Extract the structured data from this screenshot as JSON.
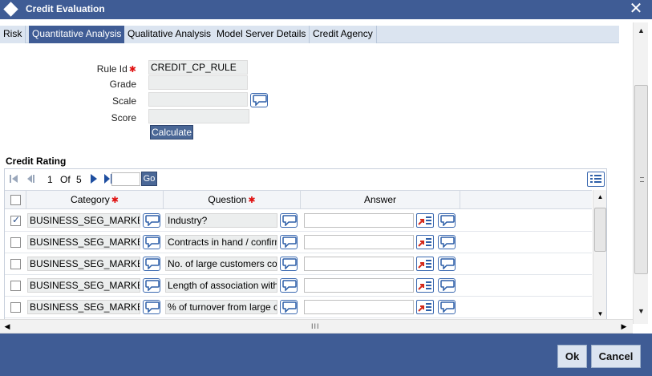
{
  "window": {
    "title": "Credit Evaluation",
    "close_label": "✕"
  },
  "tabs": [
    {
      "label": "Risk",
      "active": false
    },
    {
      "label": "Quantitative Analysis",
      "active": true
    },
    {
      "label": "Qualitative Analysis",
      "active": false
    },
    {
      "label": "Model Server Details",
      "active": false
    },
    {
      "label": "Credit Agency",
      "active": false
    }
  ],
  "form": {
    "rule_id_label": "Rule Id",
    "rule_id_value": "CREDIT_CP_RULE",
    "grade_label": "Grade",
    "grade_value": "",
    "scale_label": "Scale",
    "scale_value": "",
    "score_label": "Score",
    "score_value": "",
    "calculate_label": "Calculate"
  },
  "credit_rating": {
    "section_title": "Credit Rating",
    "pager": {
      "current_page": "1",
      "of_label": "Of",
      "total_pages": "5",
      "go_label": "Go"
    },
    "columns": {
      "category": "Category",
      "question": "Question",
      "answer": "Answer"
    },
    "rows": [
      {
        "checked": true,
        "category": "BUSINESS_SEG_MARKET",
        "question": "Industry?",
        "answer": ""
      },
      {
        "checked": false,
        "category": "BUSINESS_SEG_MARKET",
        "question": "Contracts in hand / confirmed orders",
        "answer": ""
      },
      {
        "checked": false,
        "category": "BUSINESS_SEG_MARKET",
        "question": "No. of large customers contributing",
        "answer": ""
      },
      {
        "checked": false,
        "category": "BUSINESS_SEG_MARKET",
        "question": "Length of association with customers",
        "answer": ""
      },
      {
        "checked": false,
        "category": "BUSINESS_SEG_MARKET",
        "question": "% of turnover from large customers",
        "answer": ""
      }
    ]
  },
  "footer": {
    "ok_label": "Ok",
    "cancel_label": "Cancel"
  },
  "colors": {
    "primary": "#3f5c95",
    "tab_bg": "#dbe4f0",
    "required": "#e01010"
  }
}
